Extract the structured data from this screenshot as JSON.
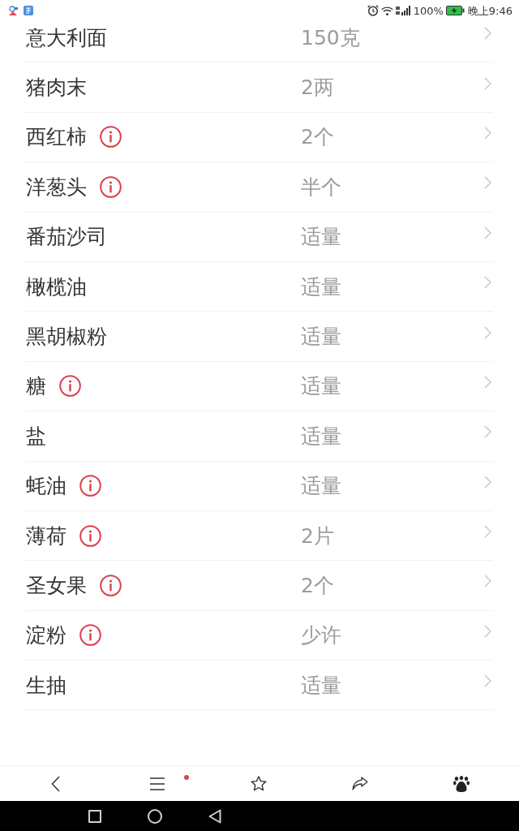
{
  "status_bar": {
    "battery_text": "100%",
    "charging": true,
    "time": "晚上9:46"
  },
  "ingredients": [
    {
      "name": "意大利面",
      "amount": "150克",
      "info": false
    },
    {
      "name": "猪肉末",
      "amount": "2两",
      "info": false
    },
    {
      "name": "西红柿",
      "amount": "2个",
      "info": true
    },
    {
      "name": "洋葱头",
      "amount": "半个",
      "info": true
    },
    {
      "name": "番茄沙司",
      "amount": "适量",
      "info": false
    },
    {
      "name": "橄榄油",
      "amount": "适量",
      "info": false
    },
    {
      "name": "黑胡椒粉",
      "amount": "适量",
      "info": false
    },
    {
      "name": "糖",
      "amount": "适量",
      "info": true
    },
    {
      "name": "盐",
      "amount": "适量",
      "info": false
    },
    {
      "name": "蚝油",
      "amount": "适量",
      "info": true
    },
    {
      "name": "薄荷",
      "amount": "2片",
      "info": true
    },
    {
      "name": "圣女果",
      "amount": "2个",
      "info": true
    },
    {
      "name": "淀粉",
      "amount": "少许",
      "info": true
    },
    {
      "name": "生抽",
      "amount": "适量",
      "info": false
    }
  ],
  "bottom_bar": {
    "menu_badge": true
  }
}
